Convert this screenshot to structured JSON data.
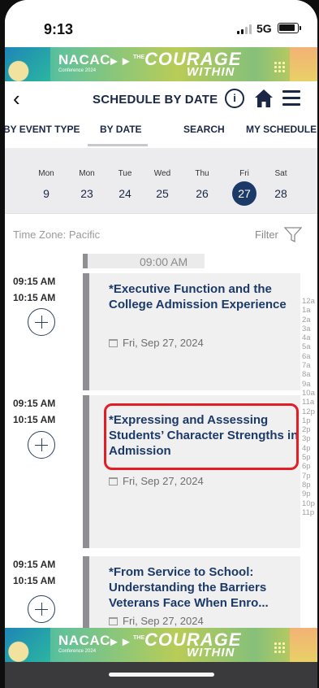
{
  "status_bar": {
    "time": "9:13",
    "network": "5G"
  },
  "banner": {
    "org": "NACAC",
    "sub": "Conference 2024",
    "the": "THE",
    "title_line1": "COURAGE",
    "title_line2": "WITHIN"
  },
  "header": {
    "title": "SCHEDULE BY DATE",
    "info_label": "i"
  },
  "tabs": [
    {
      "label": "BY EVENT TYPE"
    },
    {
      "label": "BY DATE",
      "active": true
    },
    {
      "label": "SEARCH"
    },
    {
      "label": "MY SCHEDULE"
    }
  ],
  "days": [
    {
      "name": "Mon",
      "date": "9"
    },
    {
      "name": "Mon",
      "date": "23"
    },
    {
      "name": "Tue",
      "date": "24"
    },
    {
      "name": "Wed",
      "date": "25"
    },
    {
      "name": "Thu",
      "date": "26"
    },
    {
      "name": "Fri",
      "date": "27",
      "selected": true
    },
    {
      "name": "Sat",
      "date": "28"
    }
  ],
  "timezone": "Time Zone: Pacific",
  "filter_label": "Filter",
  "time_header": "09:00 AM",
  "sessions": [
    {
      "start": "09:15 AM",
      "end": "10:15 AM",
      "title": "*Executive Function and the College Admission Experience",
      "date": "Fri, Sep 27, 2024"
    },
    {
      "start": "09:15 AM",
      "end": "10:15 AM",
      "title": "*Expressing and Assessing Students’ Character Strengths in Admission",
      "date": "Fri, Sep 27, 2024"
    },
    {
      "start": "09:15 AM",
      "end": "10:15 AM",
      "title": "*From Service to School: Understanding the Barriers Veterans Face When Enro...",
      "date": "Fri, Sep 27, 2024"
    }
  ],
  "hour_index": [
    "12a",
    "1a",
    "2a",
    "3a",
    "4a",
    "5a",
    "6a",
    "7a",
    "8a",
    "9a",
    "10a",
    "11a",
    "12p",
    "1p",
    "2p",
    "3p",
    "4p",
    "5p",
    "6p",
    "7p",
    "8p",
    "9p",
    "10p",
    "11p"
  ],
  "colors": {
    "accent": "#1c3a68",
    "highlight": "#e21d24",
    "card_bar": "#8e8e93"
  }
}
